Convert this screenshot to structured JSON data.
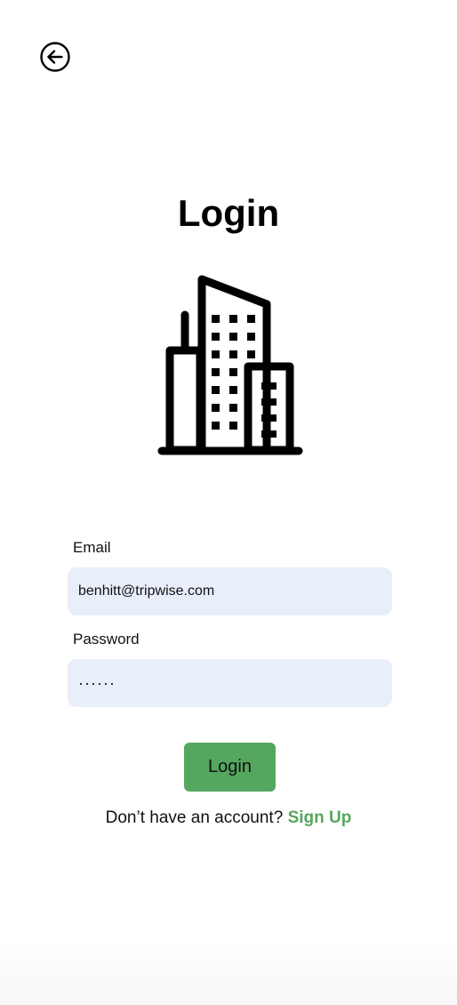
{
  "header": {
    "back_icon": "arrow-left-circle-icon"
  },
  "page": {
    "title": "Login",
    "illustration_icon": "office-building-icon"
  },
  "form": {
    "email_label": "Email",
    "email_value": "benhitt@tripwise.com",
    "password_label": "Password",
    "password_value": "······",
    "login_label": "Login"
  },
  "footer": {
    "prompt": "Don’t have an account?",
    "signup_label": "Sign Up"
  },
  "colors": {
    "accent": "#55a75f",
    "input_background": "#e8effb"
  }
}
